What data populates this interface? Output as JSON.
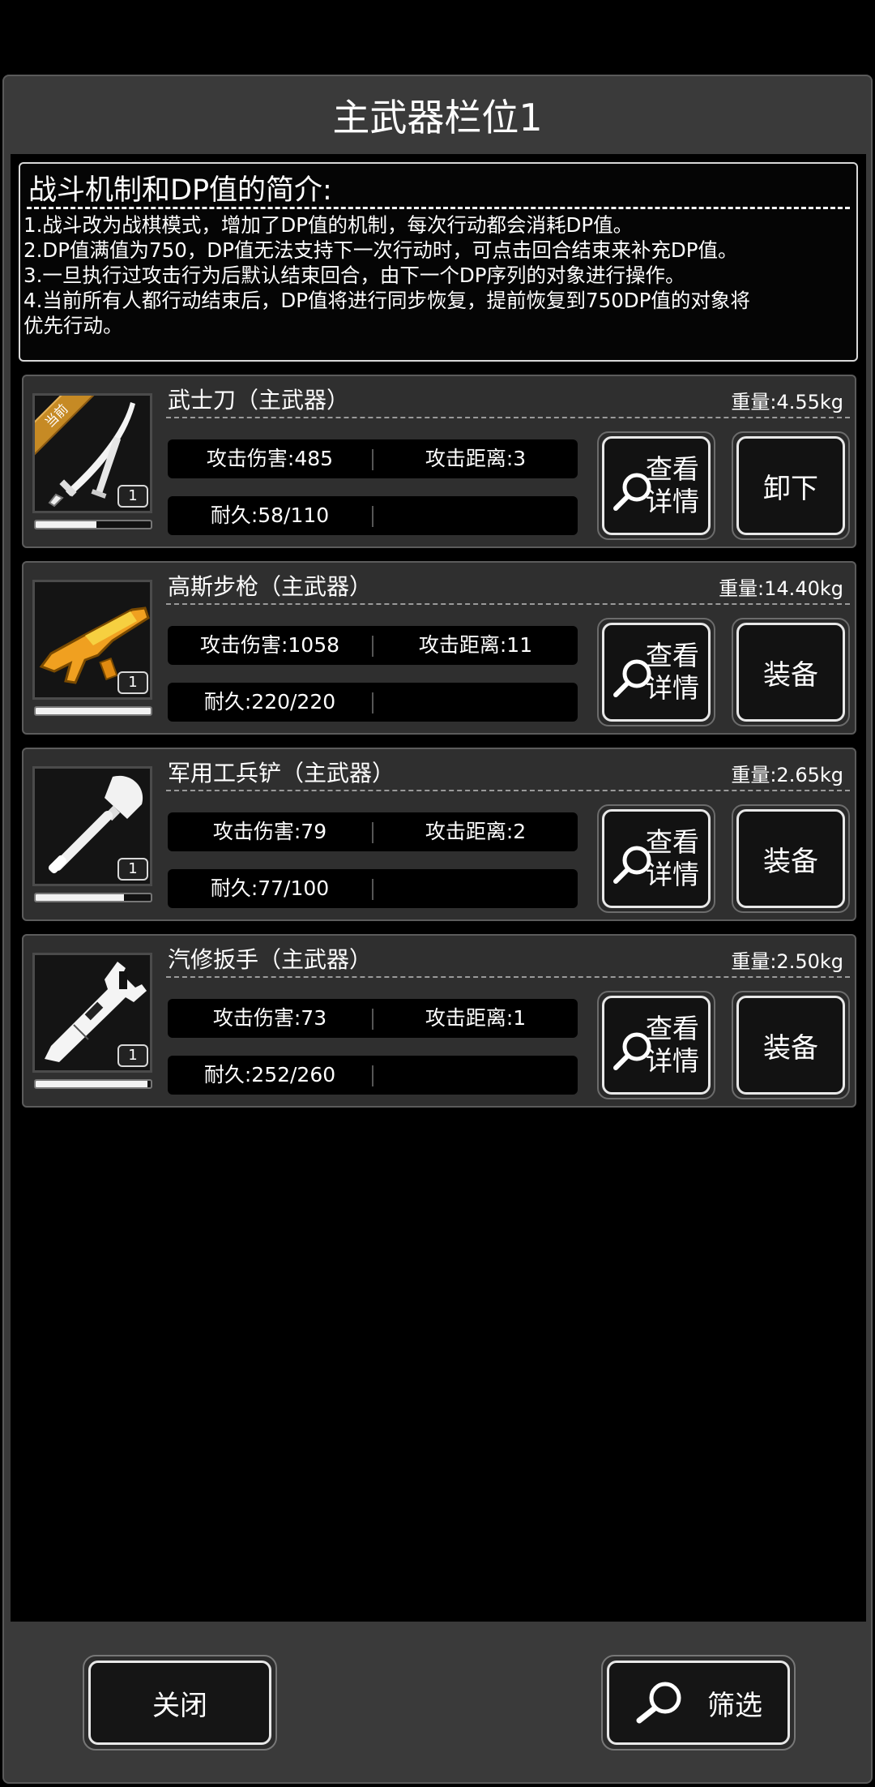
{
  "title": "主武器栏位1",
  "info": {
    "heading": "战斗机制和DP值的简介:",
    "lines": [
      "1.战斗改为战棋模式，增加了DP值的机制，每次行动都会消耗DP值。",
      "2.DP值满值为750，DP值无法支持下一次行动时，可点击回合结束来补充DP值。",
      "3.一旦执行过攻击行为后默认结束回合，由下一个DP序列的对象进行操作。",
      "4.当前所有人都行动结束后，DP值将进行同步恢复，提前恢复到750DP值的对象将",
      "优先行动。"
    ]
  },
  "weapons": [
    {
      "name": "武士刀（主武器）",
      "weight": "重量:4.55kg",
      "attack": "攻击伤害:485",
      "range": "攻击距离:3",
      "durability": "耐久:58/110",
      "durability_ratio": 0.527,
      "qty": "1",
      "badge": "当前",
      "detail_label_1": "查看",
      "detail_label_2": "详情",
      "action_label": "卸下",
      "icon": "katana-icon"
    },
    {
      "name": "高斯步枪（主武器）",
      "weight": "重量:14.40kg",
      "attack": "攻击伤害:1058",
      "range": "攻击距离:11",
      "durability": "耐久:220/220",
      "durability_ratio": 1.0,
      "qty": "1",
      "detail_label_1": "查看",
      "detail_label_2": "详情",
      "action_label": "装备",
      "icon": "gauss-rifle-icon"
    },
    {
      "name": "军用工兵铲（主武器）",
      "weight": "重量:2.65kg",
      "attack": "攻击伤害:79",
      "range": "攻击距离:2",
      "durability": "耐久:77/100",
      "durability_ratio": 0.77,
      "qty": "1",
      "detail_label_1": "查看",
      "detail_label_2": "详情",
      "action_label": "装备",
      "icon": "shovel-icon"
    },
    {
      "name": "汽修扳手（主武器）",
      "weight": "重量:2.50kg",
      "attack": "攻击伤害:73",
      "range": "攻击距离:1",
      "durability": "耐久:252/260",
      "durability_ratio": 0.969,
      "qty": "1",
      "detail_label_1": "查看",
      "detail_label_2": "详情",
      "action_label": "装备",
      "icon": "wrench-icon"
    }
  ],
  "footer": {
    "close_label": "关闭",
    "filter_label": "筛选"
  },
  "colors": {
    "panel_bg": "#3a3a3a",
    "card_bg": "#2f2f2f",
    "badge": "#c68a24",
    "rifle_orange": "#f0a020"
  }
}
